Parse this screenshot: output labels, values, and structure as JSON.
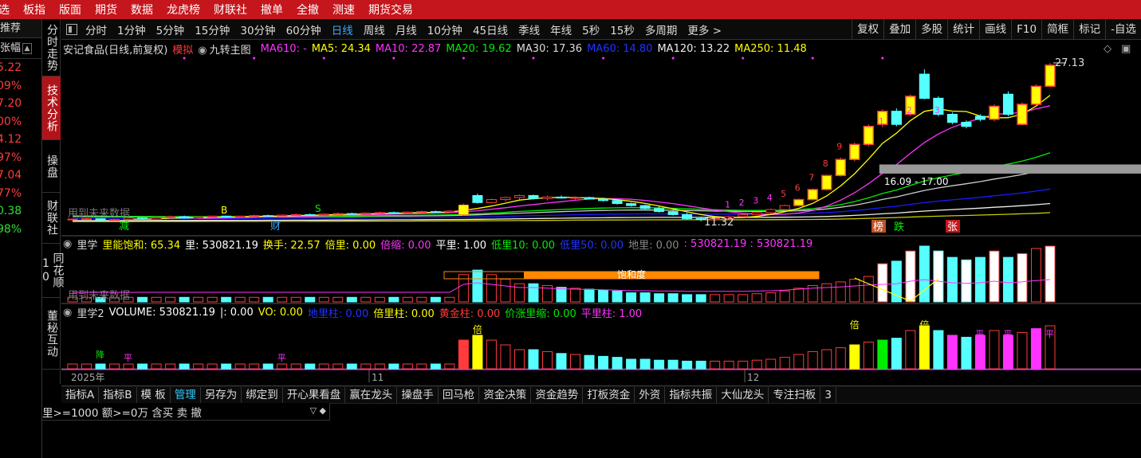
{
  "menu": [
    "选",
    "板指",
    "版面",
    "期货",
    "数据",
    "龙虎榜",
    "财联社",
    "撤单",
    "全撤",
    "测速",
    "期货交易"
  ],
  "left": {
    "hdr": "推荐",
    "hdr2": "张幅",
    "scroll_icon": "▲",
    "values": [
      {
        "v": "5.22",
        "g": false
      },
      {
        "v": "09%",
        "g": false
      },
      {
        "v": "7.20",
        "g": false
      },
      {
        "v": "00%",
        "g": false
      },
      {
        "v": "4.12",
        "g": false
      },
      {
        "v": "97%",
        "g": false
      },
      {
        "v": "7.04",
        "g": false
      },
      {
        "v": "77%",
        "g": false
      },
      {
        "v": "0.38",
        "g": true
      },
      {
        "v": "98%",
        "g": true
      }
    ]
  },
  "sidetabs": [
    {
      "label": "分时走势",
      "active": false
    },
    {
      "label": "技术分析",
      "active": true
    },
    {
      "label": "操盘",
      "active": false
    },
    {
      "label": "财联社",
      "active": false
    },
    {
      "label": "同花顺10",
      "active": false
    },
    {
      "label": "董秘互动",
      "active": false
    }
  ],
  "toolbar": {
    "periods": [
      "分时",
      "1分钟",
      "5分钟",
      "15分钟",
      "30分钟",
      "60分钟",
      "日线",
      "周线",
      "月线",
      "10分钟",
      "45日线",
      "季线",
      "年线",
      "5秒",
      "15秒",
      "多周期",
      "更多 >"
    ],
    "selected": "日线",
    "right": [
      "复权",
      "叠加",
      "多股",
      "统计",
      "画线",
      "F10",
      "简框",
      "标记",
      "-自选"
    ]
  },
  "main_legend": {
    "title": "安记食品(日线,前复权)",
    "sim": "模拟",
    "indicator": "九转主图",
    "ma610": "MA610: -",
    "ma5": "MA5: 24.34",
    "ma10": "MA10: 22.87",
    "ma20": "MA20: 19.62",
    "ma30": "MA30: 17.36",
    "ma60": "MA60: 14.80",
    "ma120": "MA120: 13.22",
    "ma250": "MA250: 11.48"
  },
  "annot": {
    "high": "27.13",
    "low": "11.32",
    "range": "16.09 - 17.00",
    "reduce": "减",
    "cai": "财",
    "bang": "榜",
    "die": "跌",
    "zhang": "张",
    "used_future": "用到未来数据",
    "b_mark": "B",
    "s_mark": "S",
    "saturation": "饱和度",
    "bei": "倍",
    "jiang": "降",
    "ping": "平"
  },
  "nines": [
    {
      "n": "1"
    },
    {
      "n": "2"
    },
    {
      "n": "3"
    },
    {
      "n": "4"
    },
    {
      "n": "5"
    },
    {
      "n": "6"
    },
    {
      "n": "7"
    },
    {
      "n": "8"
    },
    {
      "n": "9"
    },
    {
      "n": "1"
    },
    {
      "n": "2"
    },
    {
      "n": "3"
    }
  ],
  "vol_legend": {
    "name": "里学",
    "sat": "里能饱和: 65.34",
    "vol": "里: 530821.19",
    "turn": "换手: 22.57",
    "bl": "倍里: 0.00",
    "bs": "倍缩: 0.00",
    "pl": "平里: 1.00",
    "dl10": "低里10: 0.00",
    "dl50": "低里50: 0.00",
    "dl": "地里: 0.00",
    "tail": ": 530821.19 : 530821.19"
  },
  "vol2_legend": {
    "name": "里学2",
    "vol": "VOLUME: 530821.19",
    "sep": "|: 0.00",
    "vo": "VO: 0.00",
    "dlz": "地里柱: 0.00",
    "blz": "倍里柱: 0.00",
    "hjz": "黄金柱: 0.00",
    "jzls": "价涨里缩: 0.00",
    "plz": "平里柱: 1.00"
  },
  "xaxis": {
    "y2025": "2025年",
    "m11": "11",
    "m12": "12"
  },
  "bottom_tabs": [
    "指标A",
    "指标B",
    "模 板",
    "管理",
    "另存为",
    "绑定到",
    "开心果看盘",
    "赢在龙头",
    "操盘手",
    "回马枪",
    "资金决策",
    "资金趋势",
    "打板资金",
    "外资",
    "指标共振",
    "大仙龙头",
    "专注扫板",
    "3"
  ],
  "bottom_selected": "管理",
  "filter": {
    "text": "里>=1000 额>=0万 含买 卖 撤",
    "icon": "▽ ◆"
  },
  "colors": {
    "red": "#ff3b3b",
    "cyan": "#55ffff",
    "yellow": "#ffff00",
    "magenta": "#ff33ff",
    "green": "#00ee00",
    "blue": "#1a1aff",
    "white": "#ffffff",
    "orange": "#ff8800"
  },
  "chart_data": {
    "type": "candlestick",
    "last_close": 27.13,
    "period_high": 27.13,
    "period_low": 11.32,
    "candles": [
      [
        11.5,
        11.6,
        11.4,
        11.55
      ],
      [
        11.55,
        11.7,
        11.5,
        11.6
      ],
      [
        11.6,
        11.6,
        11.4,
        11.45
      ],
      [
        11.45,
        11.6,
        11.4,
        11.5
      ],
      [
        11.5,
        11.7,
        11.5,
        11.65
      ],
      [
        11.65,
        11.7,
        11.5,
        11.55
      ],
      [
        11.55,
        11.8,
        11.5,
        11.7
      ],
      [
        11.7,
        11.9,
        11.6,
        11.8
      ],
      [
        11.8,
        11.9,
        11.6,
        11.65
      ],
      [
        11.65,
        11.8,
        11.6,
        11.75
      ],
      [
        11.75,
        11.9,
        11.7,
        11.85
      ],
      [
        11.85,
        11.9,
        11.7,
        11.75
      ],
      [
        11.75,
        11.9,
        11.7,
        11.85
      ],
      [
        11.85,
        12.0,
        11.8,
        11.9
      ],
      [
        11.9,
        12.0,
        11.8,
        11.85
      ],
      [
        11.85,
        12.0,
        11.8,
        11.95
      ],
      [
        11.95,
        12.1,
        11.9,
        12.0
      ],
      [
        12.0,
        12.1,
        11.9,
        11.95
      ],
      [
        11.95,
        12.1,
        11.9,
        12.05
      ],
      [
        12.05,
        12.2,
        12.0,
        12.1
      ],
      [
        12.1,
        12.2,
        12.0,
        12.05
      ],
      [
        12.05,
        12.2,
        12.0,
        12.15
      ],
      [
        12.15,
        12.3,
        12.1,
        12.2
      ],
      [
        12.2,
        12.3,
        12.1,
        12.15
      ],
      [
        12.15,
        12.3,
        12.1,
        12.25
      ],
      [
        12.25,
        12.4,
        12.2,
        12.3
      ],
      [
        12.3,
        12.4,
        12.2,
        12.25
      ],
      [
        12.25,
        12.4,
        12.2,
        12.35
      ],
      [
        12.0,
        13.1,
        11.9,
        12.95
      ],
      [
        13.9,
        14.1,
        13.1,
        13.2
      ],
      [
        13.2,
        13.6,
        13.1,
        13.5
      ],
      [
        13.5,
        13.8,
        13.3,
        13.7
      ],
      [
        13.7,
        14.0,
        13.5,
        13.9
      ],
      [
        13.9,
        14.0,
        13.5,
        13.6
      ],
      [
        13.6,
        13.9,
        13.4,
        13.75
      ],
      [
        13.75,
        13.9,
        13.6,
        13.65
      ],
      [
        13.65,
        13.8,
        13.5,
        13.7
      ],
      [
        13.7,
        13.8,
        13.5,
        13.55
      ],
      [
        13.55,
        13.7,
        13.3,
        13.4
      ],
      [
        13.4,
        13.5,
        13.0,
        13.1
      ],
      [
        13.1,
        13.2,
        12.8,
        12.9
      ],
      [
        12.9,
        13.0,
        12.5,
        12.6
      ],
      [
        12.6,
        12.8,
        12.2,
        12.3
      ],
      [
        12.3,
        12.5,
        11.9,
        12.0
      ],
      [
        12.0,
        12.2,
        11.5,
        11.6
      ],
      [
        11.6,
        11.8,
        11.32,
        11.5
      ],
      [
        11.5,
        11.7,
        11.4,
        11.6
      ],
      [
        11.6,
        11.9,
        11.5,
        11.8
      ],
      [
        11.8,
        12.1,
        11.7,
        12.0
      ],
      [
        12.0,
        12.3,
        11.9,
        12.2
      ],
      [
        12.2,
        12.6,
        12.1,
        12.5
      ],
      [
        12.5,
        13.0,
        12.4,
        12.9
      ],
      [
        12.9,
        13.6,
        12.8,
        13.5
      ],
      [
        13.5,
        14.6,
        13.4,
        14.5
      ],
      [
        14.5,
        16.0,
        14.4,
        15.9
      ],
      [
        15.9,
        17.7,
        15.8,
        17.5
      ],
      [
        17.5,
        19.2,
        17.3,
        19.0
      ],
      [
        19.0,
        21.0,
        18.8,
        20.8
      ],
      [
        21.0,
        22.5,
        20.7,
        22.3
      ],
      [
        22.3,
        22.6,
        20.8,
        21.0
      ],
      [
        22.0,
        24.0,
        21.8,
        23.8
      ],
      [
        26.0,
        26.5,
        23.5,
        23.6
      ],
      [
        23.6,
        23.8,
        21.8,
        22.0
      ],
      [
        22.0,
        22.2,
        21.0,
        21.2
      ],
      [
        21.2,
        21.4,
        20.6,
        20.8
      ],
      [
        21.8,
        22.0,
        21.3,
        21.5
      ],
      [
        21.5,
        23.0,
        21.3,
        22.8
      ],
      [
        24.0,
        24.3,
        21.8,
        22.0
      ],
      [
        21.0,
        23.2,
        20.9,
        23.0
      ],
      [
        23.0,
        25.0,
        22.9,
        24.8
      ],
      [
        24.8,
        27.13,
        24.7,
        26.9
      ]
    ]
  }
}
